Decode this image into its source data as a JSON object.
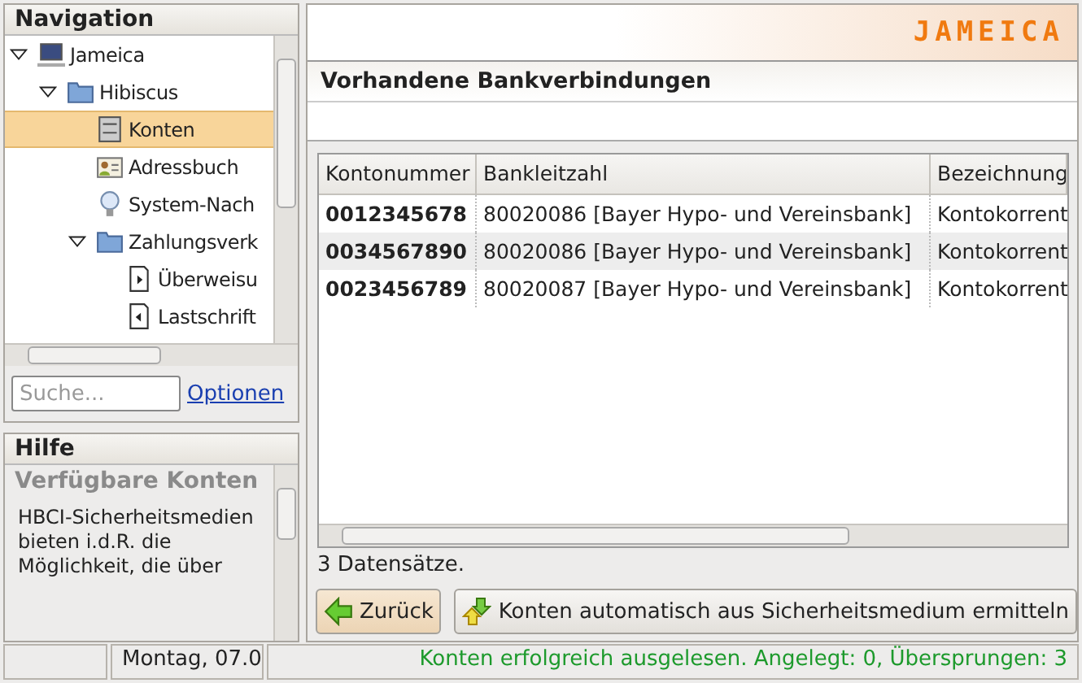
{
  "navigation": {
    "title": "Navigation",
    "tree": [
      {
        "label": "Jameica",
        "kind": "computer",
        "expanded": true,
        "selected": false,
        "children": [
          {
            "label": "Hibiscus",
            "kind": "folder",
            "expanded": true,
            "selected": false,
            "children": [
              {
                "label": "Konten",
                "kind": "cabinet",
                "selected": true
              },
              {
                "label": "Adressbuch",
                "kind": "contact",
                "selected": false
              },
              {
                "label": "System-Nach",
                "kind": "bulb",
                "selected": false
              },
              {
                "label": "Zahlungsverk",
                "kind": "folder",
                "expanded": true,
                "selected": false,
                "children": [
                  {
                    "label": "Überweisu",
                    "kind": "docright",
                    "selected": false
                  },
                  {
                    "label": "Lastschrift",
                    "kind": "docleft",
                    "selected": false
                  }
                ]
              }
            ]
          }
        ]
      }
    ],
    "search": {
      "placeholder": "Suche..."
    },
    "options_link": "Optionen"
  },
  "help": {
    "title": "Hilfe",
    "heading": "Verfügbare Konten",
    "text": "HBCI-Sicherheitsmedien bieten i.d.R. die Möglichkeit, die über"
  },
  "logo": "JAMEICA",
  "page": {
    "title": "Vorhandene Bankverbindungen",
    "table": {
      "columns": [
        "Kontonummer",
        "Bankleitzahl",
        "Bezeichnung"
      ],
      "rows": [
        {
          "cells": [
            "0012345678",
            "80020086 [Bayer Hypo- und Vereinsbank]",
            "Kontokorrent"
          ],
          "selected": false
        },
        {
          "cells": [
            "0034567890",
            "80020086 [Bayer Hypo- und Vereinsbank]",
            "Kontokorrent"
          ],
          "selected": false
        },
        {
          "cells": [
            "0023456789",
            "80020087 [Bayer Hypo- und Vereinsbank]",
            "Kontokorrent"
          ],
          "selected": false
        }
      ]
    },
    "record_count": "3 Datensätze.",
    "buttons": [
      {
        "label": "Zurück",
        "kind": "back"
      },
      {
        "label": "Konten automatisch aus Sicherheitsmedium ermitteln",
        "kind": "sync"
      }
    ]
  },
  "status_bar": {
    "date": "Montag, 07.0",
    "message": "Konten erfolgreich ausgelesen. Angelegt: 0, Übersprungen: 3"
  }
}
